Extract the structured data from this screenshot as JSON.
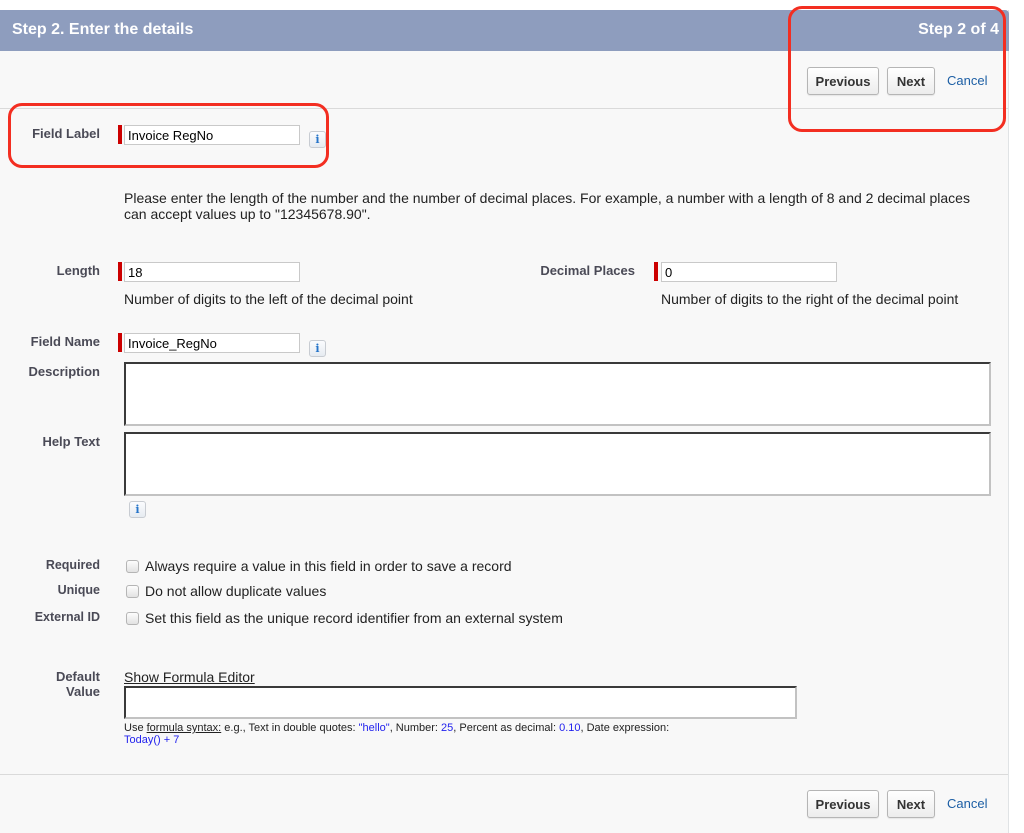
{
  "header": {
    "title": "Step 2. Enter the details",
    "step_indicator": "Step 2 of 4"
  },
  "buttons": {
    "previous": "Previous",
    "next": "Next",
    "cancel": "Cancel"
  },
  "fields": {
    "field_label": {
      "label": "Field Label",
      "value": "Invoice RegNo"
    },
    "intro_text": "Please enter the length of the number and the number of decimal places. For example, a number with a length of 8 and 2 decimal places can accept values up to \"12345678.90\".",
    "length": {
      "label": "Length",
      "value": "18",
      "hint": "Number of digits to the left of the decimal point"
    },
    "decimal_places": {
      "label": "Decimal Places",
      "value": "0",
      "hint": "Number of digits to the right of the decimal point"
    },
    "field_name": {
      "label": "Field Name",
      "value": "Invoice_RegNo"
    },
    "description": {
      "label": "Description",
      "value": ""
    },
    "help_text": {
      "label": "Help Text",
      "value": ""
    },
    "required": {
      "label": "Required",
      "text": "Always require a value in this field in order to save a record",
      "checked": false
    },
    "unique": {
      "label": "Unique",
      "text": "Do not allow duplicate values",
      "checked": false
    },
    "external_id": {
      "label": "External ID",
      "text": "Set this field as the unique record identifier from an external system",
      "checked": false
    },
    "default_value": {
      "label_line1": "Default",
      "label_line2": "Value",
      "formula_editor_link": "Show Formula Editor",
      "value": "",
      "help": {
        "prefix": "Use ",
        "syntax_link": "formula syntax:",
        "text1": " e.g., Text in double quotes: ",
        "ex_text": "\"hello\"",
        "text2": ", Number: ",
        "ex_number": "25",
        "text3": ", Percent as decimal: ",
        "ex_percent": "0.10",
        "text4": ", Date expression:",
        "ex_date": "Today() + 7"
      }
    }
  },
  "icons": {
    "info": "i"
  },
  "colors": {
    "header_bg": "#8e9dbe",
    "required_bar": "#cc0000",
    "link": "#1d5fa5",
    "highlight": "#f32e21"
  }
}
